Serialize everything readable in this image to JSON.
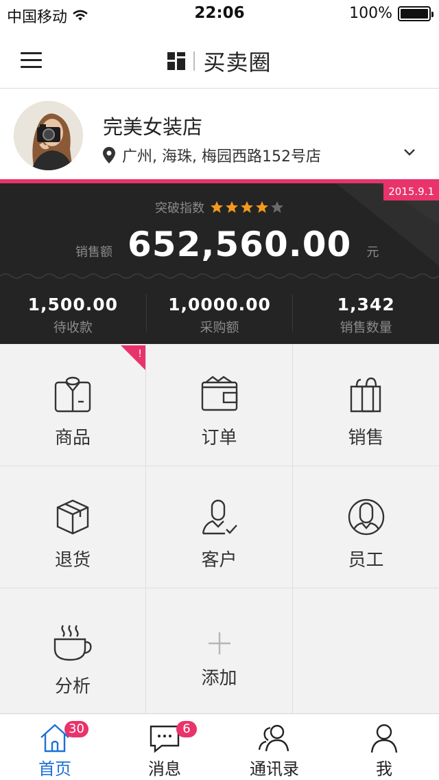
{
  "status_bar": {
    "carrier": "中国移动",
    "time": "22:06",
    "battery": "100%",
    "battery_level": 1.0
  },
  "nav": {
    "title": "买卖圈"
  },
  "profile": {
    "shop_name": "完美女装店",
    "address": "广州, 海珠, 梅园西路152号店"
  },
  "stats": {
    "date": "2015.9.1",
    "breakthrough_label": "突破指数",
    "rating": 4,
    "rating_max": 5,
    "sales_label": "销售额",
    "sales_value": "652,560.00",
    "sales_unit": "元",
    "columns": [
      {
        "value": "1,500.00",
        "label": "待收款"
      },
      {
        "value": "1,0000.00",
        "label": "采购额"
      },
      {
        "value": "1,342",
        "label": "销售数量"
      }
    ]
  },
  "grid": {
    "badge": "!",
    "items": [
      {
        "label": "商品",
        "icon": "shirt-icon"
      },
      {
        "label": "订单",
        "icon": "wallet-icon"
      },
      {
        "label": "销售",
        "icon": "shopping-bag-icon"
      },
      {
        "label": "退货",
        "icon": "package-box-icon"
      },
      {
        "label": "客户",
        "icon": "customer-check-icon"
      },
      {
        "label": "员工",
        "icon": "employee-icon"
      },
      {
        "label": "分析",
        "icon": "coffee-cup-icon"
      },
      {
        "label": "添加",
        "icon": "plus-icon"
      }
    ]
  },
  "tab_bar": {
    "items": [
      {
        "label": "首页",
        "icon": "home-icon",
        "badge": "30",
        "active": true
      },
      {
        "label": "消息",
        "icon": "chat-bubble-icon",
        "badge": "6",
        "active": false
      },
      {
        "label": "通讯录",
        "icon": "contacts-icon",
        "badge": "",
        "active": false
      },
      {
        "label": "我",
        "icon": "person-icon",
        "badge": "",
        "active": false
      }
    ]
  },
  "colors": {
    "accent": "#e8336b",
    "active_tab": "#1d6fd8",
    "star": "#f39a1e",
    "panel": "#242424"
  }
}
